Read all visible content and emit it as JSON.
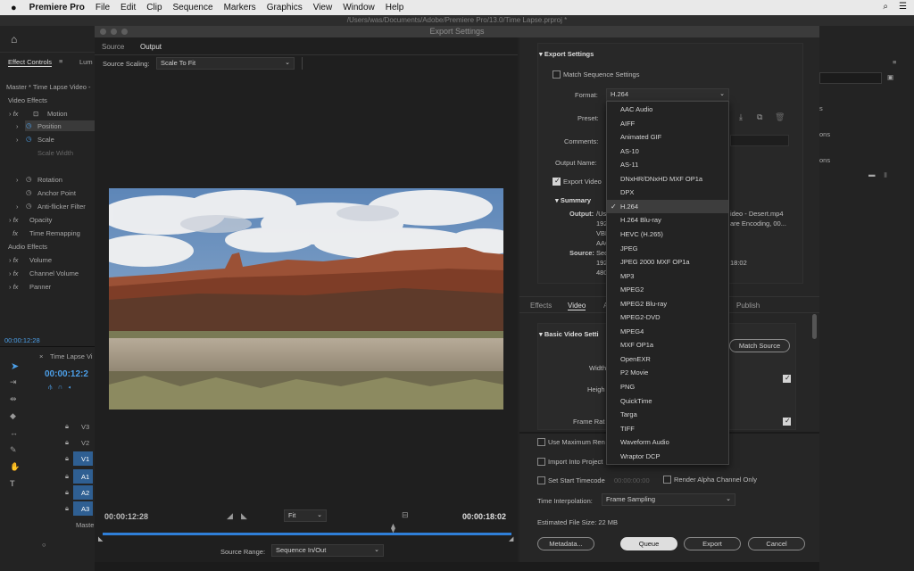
{
  "menubar": {
    "apple": "",
    "app": "Premiere Pro",
    "items": [
      "File",
      "Edit",
      "Clip",
      "Sequence",
      "Markers",
      "Graphics",
      "View",
      "Window",
      "Help"
    ]
  },
  "window_title": "/Users/was/Documents/Adobe/Premiere Pro/13.0/Time Lapse.prproj *",
  "bg": {
    "effect_controls_tab": "Effect Controls",
    "lum_tab": "Lum",
    "master_clip": "Master * Time Lapse Video -",
    "video_effects": "Video Effects",
    "motion": "Motion",
    "position": "Position",
    "scale": "Scale",
    "scale_width": "Scale Width",
    "rotation": "Rotation",
    "anchor_point": "Anchor Point",
    "anti_flicker": "Anti-flicker Filter",
    "opacity": "Opacity",
    "time_remapping": "Time Remapping",
    "audio_effects": "Audio Effects",
    "volume": "Volume",
    "channel_volume": "Channel Volume",
    "panner": "Panner",
    "timecode": "00:00:12:28",
    "timeline_tab": "Time Lapse Vi",
    "timeline_tc": "00:00:12:2",
    "tracks": [
      "V3",
      "V2",
      "V1",
      "A1",
      "A2",
      "A3",
      "Maste"
    ],
    "right_frags": [
      "s",
      "ons",
      "ons"
    ]
  },
  "dialog": {
    "title": "Export Settings",
    "tabs": {
      "source": "Source",
      "output": "Output"
    },
    "source_scaling_label": "Source Scaling:",
    "source_scaling_value": "Scale To Fit",
    "tc_current": "00:00:12:28",
    "tc_end": "00:00:18:02",
    "fit": "Fit",
    "source_range_label": "Source Range:",
    "source_range_value": "Sequence In/Out",
    "export_settings": "Export Settings",
    "match_sequence": "Match Sequence Settings",
    "format_label": "Format:",
    "format_value": "H.264",
    "preset_label": "Preset:",
    "comments_label": "Comments:",
    "output_name_label": "Output Name:",
    "export_video": "Export Video",
    "summary": "Summary",
    "output_label": "Output:",
    "output_frag": "/Us",
    "output_right1": "ideo - Desert.mp4",
    "output_right2": "are Encoding, 00...",
    "out_lines": [
      "192",
      "VBR",
      "AAC"
    ],
    "source_label": "Source:",
    "source_frag": "Seq",
    "source_lines": [
      "192",
      "480"
    ],
    "source_right": "18:02",
    "lower_tabs": [
      "Effects",
      "Video",
      "A",
      "Publish"
    ],
    "basic_video": "Basic Video Setti",
    "match_source": "Match Source",
    "width_label": "Width",
    "height_label": "Heigh",
    "frame_rate_label": "Frame Rat",
    "use_max_render": "Use Maximum Ren",
    "import_into_project": "Import Into Project",
    "set_start_tc": "Set Start Timecode",
    "start_tc_value": "00:00:00:00",
    "render_alpha": "Render Alpha Channel Only",
    "time_interp_label": "Time Interpolation:",
    "time_interp_value": "Frame Sampling",
    "est_size": "Estimated File Size:  22 MB",
    "buttons": {
      "metadata": "Metadata...",
      "queue": "Queue",
      "export": "Export",
      "cancel": "Cancel"
    }
  },
  "format_menu": {
    "items": [
      "AAC Audio",
      "AIFF",
      "Animated GIF",
      "AS-10",
      "AS-11",
      "DNxHR/DNxHD MXF OP1a",
      "DPX",
      "H.264",
      "H.264 Blu-ray",
      "HEVC (H.265)",
      "JPEG",
      "JPEG 2000 MXF OP1a",
      "MP3",
      "MPEG2",
      "MPEG2 Blu-ray",
      "MPEG2-DVD",
      "MPEG4",
      "MXF OP1a",
      "OpenEXR",
      "P2 Movie",
      "PNG",
      "QuickTime",
      "Targa",
      "TIFF",
      "Waveform Audio",
      "Wraptor DCP"
    ],
    "selected": "H.264",
    "check": "✓"
  },
  "colors": {
    "accent": "#4c9fe8",
    "selected_blue": "#2f5f92"
  }
}
